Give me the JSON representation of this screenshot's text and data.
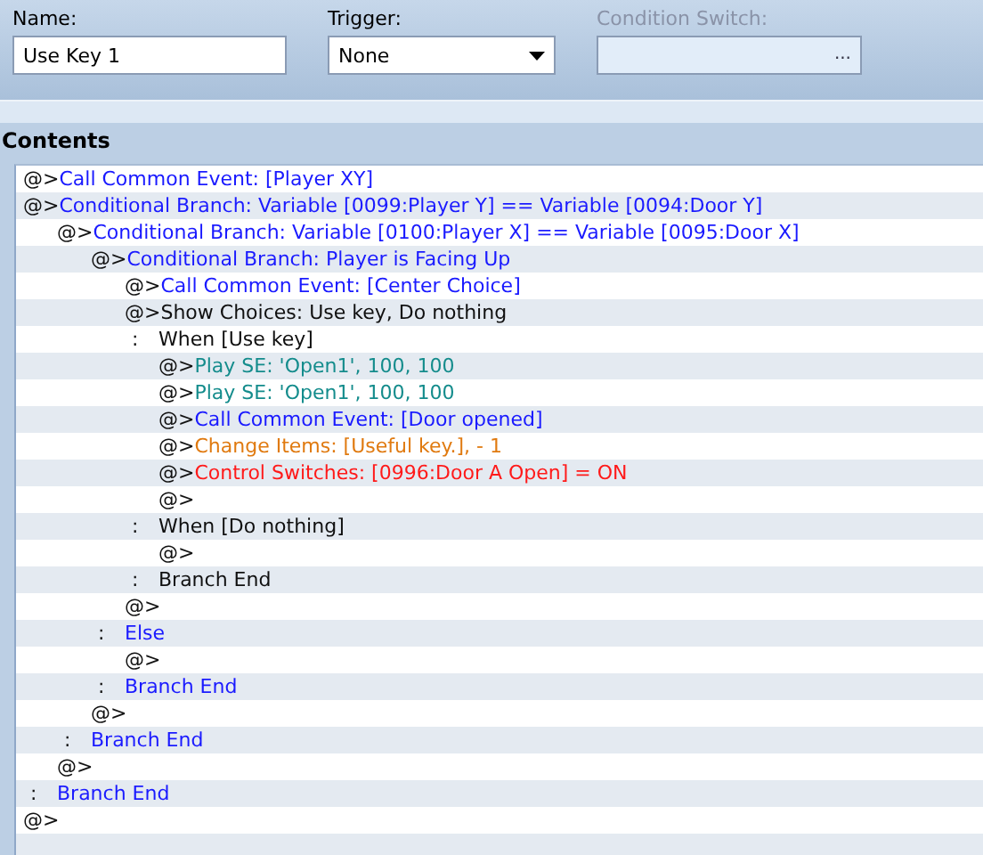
{
  "name_field": {
    "label": "Name:",
    "value": "Use Key 1"
  },
  "trigger_field": {
    "label": "Trigger:",
    "value": "None"
  },
  "condition_switch": {
    "label": "Condition Switch:",
    "disabled": true,
    "button": "..."
  },
  "contents": {
    "title": "Contents",
    "commands": [
      {
        "kind": "command",
        "prefix": "@>",
        "text": "Call Common Event: [Player XY]",
        "color": "#1a1aff"
      },
      {
        "kind": "command",
        "prefix": "@>",
        "text": "Conditional Branch: Variable [0099:Player Y] == Variable [0094:Door Y]",
        "color": "#1a1aff",
        "children": [
          {
            "kind": "command",
            "prefix": "@>",
            "text": "Conditional Branch: Variable [0100:Player X] == Variable [0095:Door X]",
            "color": "#1a1aff",
            "children": [
              {
                "kind": "command",
                "prefix": "@>",
                "text": "Conditional Branch: Player is Facing Up",
                "color": "#1a1aff",
                "children": [
                  {
                    "kind": "command",
                    "prefix": "@>",
                    "text": "Call Common Event: [Center Choice]",
                    "color": "#1a1aff"
                  },
                  {
                    "kind": "command",
                    "prefix": "@>",
                    "text": "Show Choices: Use key, Do nothing",
                    "color": "#101010"
                  },
                  {
                    "kind": "label",
                    "prefix": ":",
                    "text": "When [Use key]",
                    "color": "#101010",
                    "children": [
                      {
                        "kind": "command",
                        "prefix": "@>",
                        "text": "Play SE: 'Open1', 100, 100",
                        "color": "#148c8c"
                      },
                      {
                        "kind": "command",
                        "prefix": "@>",
                        "text": "Play SE: 'Open1', 100, 100",
                        "color": "#148c8c"
                      },
                      {
                        "kind": "command",
                        "prefix": "@>",
                        "text": "Call Common Event: [Door opened]",
                        "color": "#1a1aff"
                      },
                      {
                        "kind": "command",
                        "prefix": "@>",
                        "text": "Change Items: [Useful key.], - 1",
                        "color": "#e07a10"
                      },
                      {
                        "kind": "command",
                        "prefix": "@>",
                        "text": "Control Switches: [0996:Door A Open] = ON",
                        "color": "#ff1a1a"
                      },
                      {
                        "kind": "command",
                        "prefix": "@>"
                      }
                    ]
                  },
                  {
                    "kind": "label",
                    "prefix": ":",
                    "text": "When [Do nothing]",
                    "color": "#101010",
                    "children": [
                      {
                        "kind": "command",
                        "prefix": "@>"
                      }
                    ]
                  },
                  {
                    "kind": "label",
                    "prefix": ":",
                    "text": "Branch End",
                    "color": "#101010"
                  },
                  {
                    "kind": "command",
                    "prefix": "@>"
                  }
                ]
              },
              {
                "kind": "label",
                "prefix": ":",
                "text": "Else",
                "color": "#1a1aff",
                "children": [
                  {
                    "kind": "command",
                    "prefix": "@>"
                  }
                ]
              },
              {
                "kind": "label",
                "prefix": ":",
                "text": "Branch End",
                "color": "#1a1aff"
              },
              {
                "kind": "command",
                "prefix": "@>"
              }
            ]
          },
          {
            "kind": "label",
            "prefix": ":",
            "text": "Branch End",
            "color": "#1a1aff"
          },
          {
            "kind": "command",
            "prefix": "@>"
          }
        ]
      },
      {
        "kind": "label",
        "prefix": ":",
        "text": "Branch End",
        "color": "#1a1aff"
      },
      {
        "kind": "command",
        "prefix": "@>"
      }
    ]
  }
}
